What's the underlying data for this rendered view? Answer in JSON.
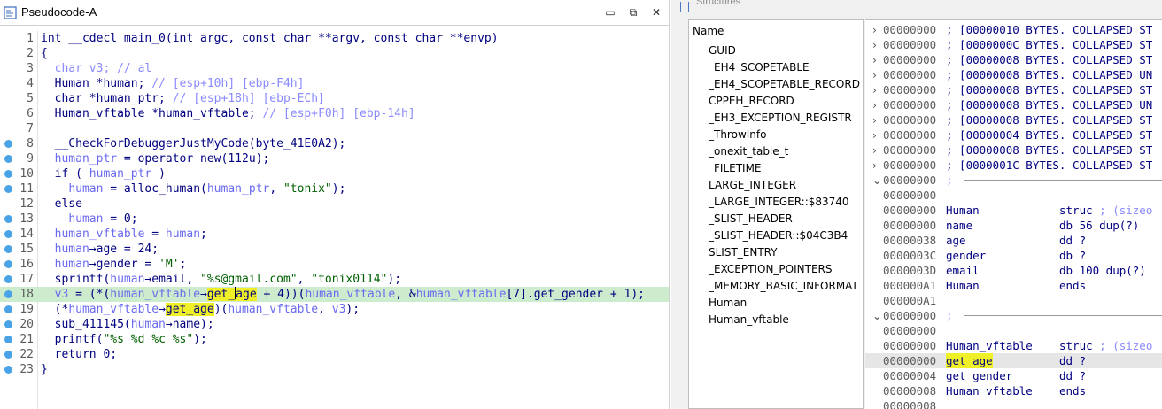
{
  "pseudocode": {
    "title": "Pseudocode-A",
    "window_buttons": {
      "minimize": "▭",
      "restore": "⧉",
      "close": "✕"
    },
    "lines": [
      {
        "n": "1",
        "dot": false,
        "current": false,
        "html": "int __cdecl main_0(int argc, const char **argv, const char **envp)"
      },
      {
        "n": "2",
        "dot": false,
        "current": false,
        "html": "{"
      },
      {
        "n": "3",
        "dot": false,
        "current": false,
        "html": "  <span class=\"c\">char v3; // al</span>"
      },
      {
        "n": "4",
        "dot": false,
        "current": false,
        "html": "  Human *human; <span class=\"c\">// [esp+10h] [ebp-F4h]</span>"
      },
      {
        "n": "5",
        "dot": false,
        "current": false,
        "html": "  char *human_ptr; <span class=\"c\">// [esp+18h] [ebp-ECh]</span>"
      },
      {
        "n": "6",
        "dot": false,
        "current": false,
        "html": "  Human_vftable *human_vftable; <span class=\"c\">// [esp+F0h] [ebp-14h]</span>"
      },
      {
        "n": "7",
        "dot": false,
        "current": false,
        "html": ""
      },
      {
        "n": "8",
        "dot": true,
        "current": false,
        "html": "  __CheckForDebuggerJustMyCode(byte_41E0A2);"
      },
      {
        "n": "9",
        "dot": true,
        "current": false,
        "html": "  <span class=\"v\">human_ptr</span> = operator new(112u);"
      },
      {
        "n": "10",
        "dot": true,
        "current": false,
        "html": "  if ( <span class=\"v\">human_ptr</span> )"
      },
      {
        "n": "11",
        "dot": true,
        "current": false,
        "html": "    <span class=\"v\">human</span> = alloc_human(<span class=\"v\">human_ptr</span>, <span class=\"s\">\"tonix\"</span>);"
      },
      {
        "n": "12",
        "dot": false,
        "current": false,
        "html": "  else"
      },
      {
        "n": "13",
        "dot": true,
        "current": false,
        "html": "    <span class=\"v\">human</span> = 0;"
      },
      {
        "n": "14",
        "dot": true,
        "current": false,
        "html": "  <span class=\"v\">human_vftable</span> = <span class=\"v\">human</span>;"
      },
      {
        "n": "15",
        "dot": true,
        "current": false,
        "html": "  <span class=\"v\">human</span>→age = 24;"
      },
      {
        "n": "16",
        "dot": true,
        "current": false,
        "html": "  <span class=\"v\">human</span>→gender = <span class=\"s\">'M'</span>;"
      },
      {
        "n": "17",
        "dot": true,
        "current": false,
        "html": "  sprintf(<span class=\"v\">human</span>→email, <span class=\"s\">\"%s@gmail.com\"</span>, <span class=\"s\">\"tonix0114\"</span>);"
      },
      {
        "n": "18",
        "dot": true,
        "current": true,
        "html": "  <span class=\"v\">v3</span> = (*(<span class=\"v\">human_vftable</span>→<span class=\"hl\">get_<i class=\"caret\"></i>age</span> + 4))(<span class=\"v\">human_vftable</span>, &amp;<span class=\"v\">human_vftable</span>[7].get_gender + 1);"
      },
      {
        "n": "19",
        "dot": true,
        "current": false,
        "html": "  (*<span class=\"v\">human_vftable</span>→<span class=\"hl\">get_age</span>)(<span class=\"v\">human_vftable</span>, <span class=\"v\">v3</span>);"
      },
      {
        "n": "20",
        "dot": true,
        "current": false,
        "html": "  sub_411145(<span class=\"v\">human</span>→name);"
      },
      {
        "n": "21",
        "dot": true,
        "current": false,
        "html": "  printf(<span class=\"s\">\"%s %d %c %s\"</span>);"
      },
      {
        "n": "22",
        "dot": true,
        "current": false,
        "html": "  return 0;"
      },
      {
        "n": "23",
        "dot": true,
        "current": false,
        "html": "}"
      }
    ]
  },
  "structures": {
    "title": "Structures",
    "list_header": "Name",
    "items": [
      "GUID",
      "_EH4_SCOPETABLE",
      "_EH4_SCOPETABLE_RECORD",
      "CPPEH_RECORD",
      "_EH3_EXCEPTION_REGISTR",
      "_ThrowInfo",
      "_onexit_table_t",
      "_FILETIME",
      "LARGE_INTEGER",
      "_LARGE_INTEGER::$83740",
      "_SLIST_HEADER",
      "_SLIST_HEADER::$04C3B4",
      "SLIST_ENTRY",
      "_EXCEPTION_POINTERS",
      "_MEMORY_BASIC_INFORMAT",
      "Human",
      "Human_vftable"
    ],
    "detail_rows": [
      {
        "tri": "›",
        "addr": "00000000",
        "txt": "; [00000010 BYTES. COLLAPSED ST",
        "col3": "",
        "kind": "collapsed"
      },
      {
        "tri": "›",
        "addr": "00000000",
        "txt": "; [0000000C BYTES. COLLAPSED ST",
        "col3": "",
        "kind": "collapsed"
      },
      {
        "tri": "›",
        "addr": "00000000",
        "txt": "; [00000008 BYTES. COLLAPSED ST",
        "col3": "",
        "kind": "collapsed"
      },
      {
        "tri": "›",
        "addr": "00000000",
        "txt": "; [00000008 BYTES. COLLAPSED UN",
        "col3": "",
        "kind": "collapsed"
      },
      {
        "tri": "›",
        "addr": "00000000",
        "txt": "; [00000008 BYTES. COLLAPSED ST",
        "col3": "",
        "kind": "collapsed"
      },
      {
        "tri": "›",
        "addr": "00000000",
        "txt": "; [00000008 BYTES. COLLAPSED UN",
        "col3": "",
        "kind": "collapsed"
      },
      {
        "tri": "›",
        "addr": "00000000",
        "txt": "; [00000008 BYTES. COLLAPSED ST",
        "col3": "",
        "kind": "collapsed"
      },
      {
        "tri": "›",
        "addr": "00000000",
        "txt": "; [00000004 BYTES. COLLAPSED ST",
        "col3": "",
        "kind": "collapsed"
      },
      {
        "tri": "›",
        "addr": "00000000",
        "txt": "; [00000008 BYTES. COLLAPSED ST",
        "col3": "",
        "kind": "collapsed"
      },
      {
        "tri": "›",
        "addr": "00000000",
        "txt": "; [0000001C BYTES. COLLAPSED ST",
        "col3": "",
        "kind": "collapsed"
      },
      {
        "tri": "⌄",
        "addr": "00000000",
        "txt": ";",
        "col3": "",
        "kind": "separator"
      },
      {
        "tri": "",
        "addr": "00000000",
        "txt": "",
        "col3": "",
        "kind": "plain"
      },
      {
        "tri": "",
        "addr": "00000000",
        "txt": "Human",
        "col3": "struc ; (sizeo",
        "kind": "struct"
      },
      {
        "tri": "",
        "addr": "00000000",
        "txt": "name",
        "col3": "db 56 dup(?)",
        "kind": "plain"
      },
      {
        "tri": "",
        "addr": "00000038",
        "txt": "age",
        "col3": "dd ?",
        "kind": "plain"
      },
      {
        "tri": "",
        "addr": "0000003C",
        "txt": "gender",
        "col3": "db ?",
        "kind": "plain"
      },
      {
        "tri": "",
        "addr": "0000003D",
        "txt": "email",
        "col3": "db 100 dup(?)",
        "kind": "plain"
      },
      {
        "tri": "",
        "addr": "000000A1",
        "txt": "Human",
        "col3": "ends",
        "kind": "plain"
      },
      {
        "tri": "",
        "addr": "000000A1",
        "txt": "",
        "col3": "",
        "kind": "plain"
      },
      {
        "tri": "⌄",
        "addr": "00000000",
        "txt": ";",
        "col3": "",
        "kind": "separator"
      },
      {
        "tri": "",
        "addr": "00000000",
        "txt": "",
        "col3": "",
        "kind": "plain"
      },
      {
        "tri": "",
        "addr": "00000000",
        "txt": "Human_vftable",
        "col3": "struc ; (sizeo",
        "kind": "struct"
      },
      {
        "tri": "",
        "addr": "00000000",
        "txt": "get_age",
        "col3": "dd ?",
        "kind": "selected"
      },
      {
        "tri": "",
        "addr": "00000004",
        "txt": "get_gender",
        "col3": "dd ?",
        "kind": "plain"
      },
      {
        "tri": "",
        "addr": "00000008",
        "txt": "Human_vftable",
        "col3": "ends",
        "kind": "plain"
      },
      {
        "tri": "",
        "addr": "00000008",
        "txt": "",
        "col3": "",
        "kind": "plain"
      }
    ]
  },
  "colors": {
    "code_text": "#000080",
    "comment": "#8a8aff",
    "string": "#006000",
    "current_line": "#cdeccd",
    "highlight": "#f0f028",
    "gutter_dot": "#4aa3e6"
  }
}
